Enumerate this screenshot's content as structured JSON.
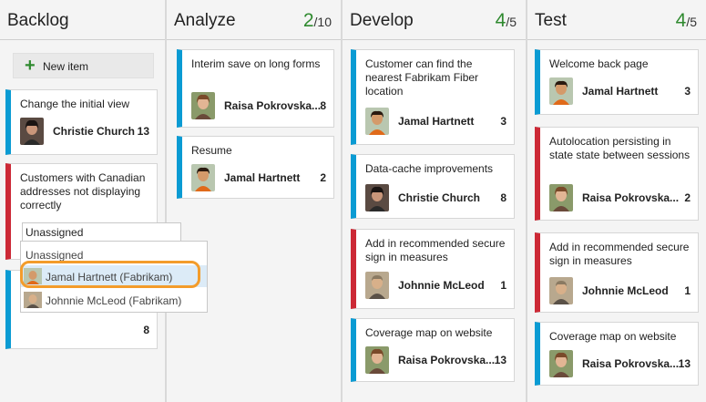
{
  "columns": [
    {
      "title": "Backlog"
    },
    {
      "title": "Analyze",
      "wip_count": "2",
      "wip_limit": "/10"
    },
    {
      "title": "Develop",
      "wip_count": "4",
      "wip_limit": "/5"
    },
    {
      "title": "Test",
      "wip_count": "4",
      "wip_limit": "/5"
    }
  ],
  "new_item_label": "New item",
  "cards": {
    "backlog_1": {
      "title": "Change the initial view",
      "assignee": "Christie Church",
      "effort": "13"
    },
    "backlog_2": {
      "title": "Customers with Canadian addresses not displaying correctly"
    },
    "backlog_3": {
      "effort": "8"
    },
    "analyze_1": {
      "title": "Interim save on long forms",
      "assignee": "Raisa Pokrovska...",
      "effort": "8"
    },
    "analyze_2": {
      "title": "Resume",
      "assignee": "Jamal Hartnett",
      "effort": "2"
    },
    "develop_1": {
      "title": "Customer can find the nearest Fabrikam Fiber location",
      "assignee": "Jamal Hartnett",
      "effort": "3"
    },
    "develop_2": {
      "title": "Data-cache improvements",
      "assignee": "Christie Church",
      "effort": "8"
    },
    "develop_3": {
      "title": "Add in recommended secure sign in measures",
      "assignee": "Johnnie McLeod",
      "effort": "1"
    },
    "develop_4": {
      "title": "Coverage map on website",
      "assignee": "Raisa Pokrovska...",
      "effort": "13"
    },
    "test_1": {
      "title": "Welcome back page",
      "assignee": "Jamal Hartnett",
      "effort": "3"
    },
    "test_2": {
      "title": "Autolocation persisting in state state between sessions",
      "assignee": "Raisa Pokrovska...",
      "effort": "2"
    },
    "test_3": {
      "title": "Add in recommended secure sign in measures",
      "assignee": "Johnnie McLeod",
      "effort": "1"
    },
    "test_4": {
      "title": "Coverage map on website",
      "assignee": "Raisa Pokrovska...",
      "effort": "13"
    }
  },
  "assign_picker": {
    "input_value": "Unassigned",
    "options": [
      "Unassigned",
      "Jamal Hartnett (Fabrikam)",
      "Johnnie McLeod (Fabrikam)"
    ]
  },
  "colors": {
    "feature": "#0a9bd3",
    "bug": "#cc2936",
    "wip": "#2f8a2f",
    "highlight": "#f39c2b"
  },
  "icons": {
    "new_item": "plus-icon"
  }
}
